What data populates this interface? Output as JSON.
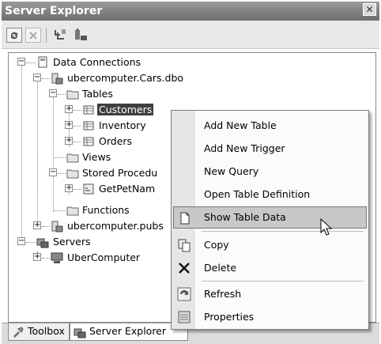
{
  "window": {
    "title": "Server Explorer",
    "close_glyph": "✕"
  },
  "toolbar": {
    "buttons": [
      "refresh-icon",
      "stop-icon",
      "connect-to-database-icon",
      "connect-to-server-icon"
    ]
  },
  "tree": {
    "data_connections": "Data Connections",
    "conn1": "ubercomputer.Cars.dbo",
    "tables": "Tables",
    "customers": "Customers",
    "inventory": "Inventory",
    "orders": "Orders",
    "views": "Views",
    "stored_procedures": "Stored Procedu",
    "getpetname": "GetPetNam",
    "functions": "Functions",
    "conn2": "ubercomputer.pubs",
    "servers": "Servers",
    "ubercomputer": "UberComputer"
  },
  "context_menu": {
    "items": [
      {
        "label": "Add New Table",
        "icon": ""
      },
      {
        "label": "Add New Trigger",
        "icon": ""
      },
      {
        "label": "New Query",
        "icon": ""
      },
      {
        "label": "Open Table Definition",
        "icon": ""
      },
      {
        "label": "Show Table Data",
        "icon": "show-data-icon",
        "highlighted": true
      },
      {
        "label": "Copy",
        "icon": "copy-icon"
      },
      {
        "label": "Delete",
        "icon": "delete-icon"
      },
      {
        "label": "Refresh",
        "icon": "refresh-icon"
      },
      {
        "label": "Properties",
        "icon": "properties-icon"
      }
    ]
  },
  "tabs": {
    "toolbox": "Toolbox",
    "server_explorer": "Server Explorer"
  },
  "colors": {
    "selection": "#3f3f3f",
    "menu_highlight": "#c8c8c8",
    "titlebar": "#7a7a7a"
  }
}
